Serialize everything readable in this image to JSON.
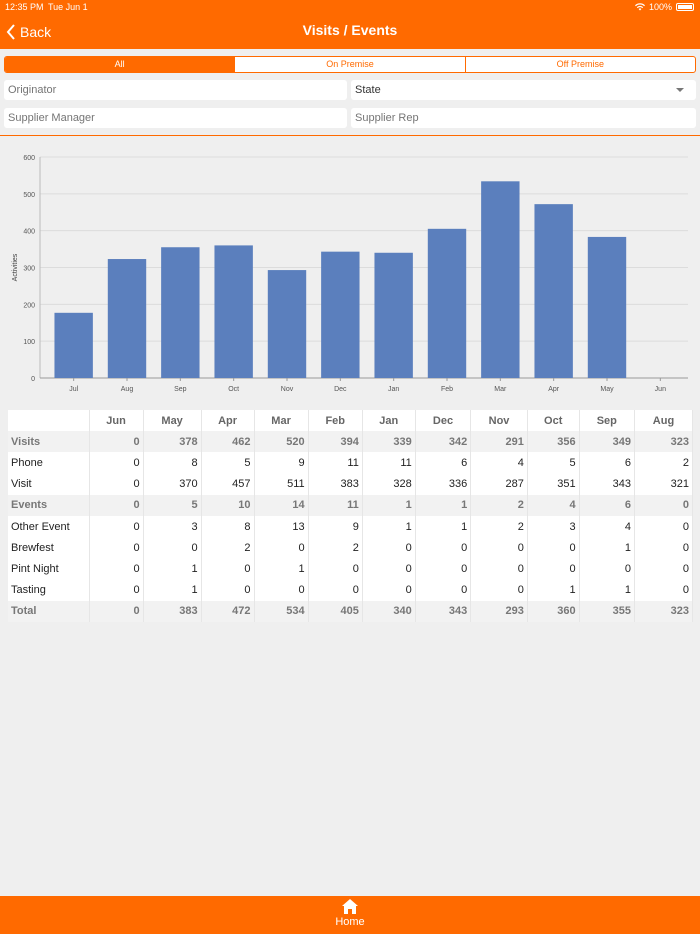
{
  "status": {
    "time": "12:35 PM",
    "date": "Tue Jun 1",
    "battery": "100%"
  },
  "nav": {
    "back_label": "Back",
    "title": "Visits / Events"
  },
  "segments": [
    {
      "label": "All",
      "active": true
    },
    {
      "label": "On Premise",
      "active": false
    },
    {
      "label": "Off Premise",
      "active": false
    }
  ],
  "filters": {
    "originator_placeholder": "Originator",
    "state_value": "State",
    "supplier_manager_placeholder": "Supplier Manager",
    "supplier_rep_placeholder": "Supplier Rep"
  },
  "colors": {
    "accent": "#ff6a00",
    "bar": "#5b7fbd"
  },
  "chart_data": {
    "type": "bar",
    "categories": [
      "Jul",
      "Aug",
      "Sep",
      "Oct",
      "Nov",
      "Dec",
      "Jan",
      "Feb",
      "Mar",
      "Apr",
      "May",
      "Jun"
    ],
    "values": [
      177,
      323,
      355,
      360,
      293,
      343,
      340,
      405,
      534,
      472,
      383,
      0
    ],
    "ylabel": "Activities",
    "ylim": [
      0,
      600
    ],
    "yticks": [
      0,
      100,
      200,
      300,
      400,
      500,
      600
    ],
    "grid": true
  },
  "table": {
    "columns": [
      "",
      "Jun",
      "May",
      "Apr",
      "Mar",
      "Feb",
      "Jan",
      "Dec",
      "Nov",
      "Oct",
      "Sep",
      "Aug"
    ],
    "rows": [
      {
        "label": "Visits",
        "group": true,
        "values": [
          "0",
          "378",
          "462",
          "520",
          "394",
          "339",
          "342",
          "291",
          "356",
          "349",
          "323"
        ]
      },
      {
        "label": "Phone",
        "group": false,
        "values": [
          "0",
          "8",
          "5",
          "9",
          "11",
          "11",
          "6",
          "4",
          "5",
          "6",
          "2"
        ]
      },
      {
        "label": "Visit",
        "group": false,
        "values": [
          "0",
          "370",
          "457",
          "511",
          "383",
          "328",
          "336",
          "287",
          "351",
          "343",
          "321"
        ]
      },
      {
        "label": "Events",
        "group": true,
        "values": [
          "0",
          "5",
          "10",
          "14",
          "11",
          "1",
          "1",
          "2",
          "4",
          "6",
          "0"
        ]
      },
      {
        "label": "Other Event",
        "group": false,
        "values": [
          "0",
          "3",
          "8",
          "13",
          "9",
          "1",
          "1",
          "2",
          "3",
          "4",
          "0"
        ]
      },
      {
        "label": "Brewfest",
        "group": false,
        "values": [
          "0",
          "0",
          "2",
          "0",
          "2",
          "0",
          "0",
          "0",
          "0",
          "1",
          "0"
        ]
      },
      {
        "label": "Pint Night",
        "group": false,
        "values": [
          "0",
          "1",
          "0",
          "1",
          "0",
          "0",
          "0",
          "0",
          "0",
          "0",
          "0"
        ]
      },
      {
        "label": "Tasting",
        "group": false,
        "values": [
          "0",
          "1",
          "0",
          "0",
          "0",
          "0",
          "0",
          "0",
          "1",
          "1",
          "0"
        ]
      },
      {
        "label": "Total",
        "group": true,
        "values": [
          "0",
          "383",
          "472",
          "534",
          "405",
          "340",
          "343",
          "293",
          "360",
          "355",
          "323"
        ]
      }
    ]
  },
  "tabbar": {
    "home_label": "Home"
  }
}
